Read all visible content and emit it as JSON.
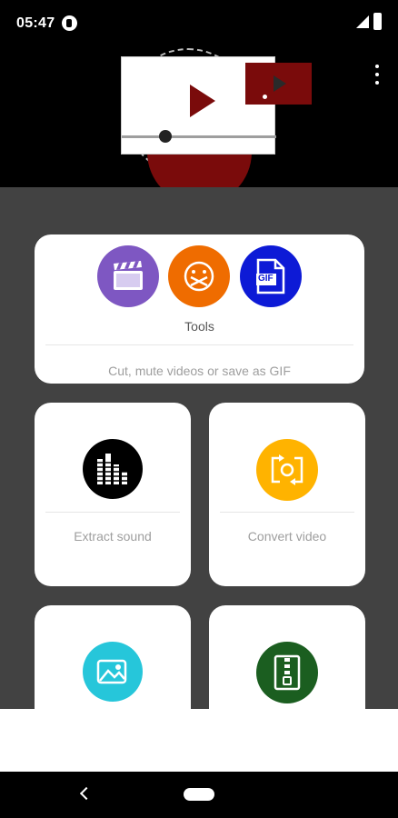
{
  "status_bar": {
    "time": "05:47",
    "app_icon": "notification-app-icon",
    "signal_icon": "cell-signal-icon",
    "battery_icon": "battery-icon"
  },
  "header": {
    "illustration_icon": "video-player-illustration",
    "menu_icon": "overflow-menu-icon"
  },
  "cards": {
    "tools": {
      "title": "Tools",
      "subtitle": "Cut, mute videos or save as GIF",
      "icons": [
        {
          "name": "clapperboard-icon",
          "color": "#7e57c2"
        },
        {
          "name": "mute-face-icon",
          "color": "#ef6c00"
        },
        {
          "name": "gif-file-icon",
          "color": "#0d1ad6"
        }
      ],
      "gif_badge": "GIF"
    },
    "extract_sound": {
      "label": "Extract sound",
      "icon": "equalizer-icon",
      "color": "#000000"
    },
    "convert_video": {
      "label": "Convert video",
      "icon": "convert-video-icon",
      "color": "#ffb300"
    },
    "images": {
      "icon": "image-icon",
      "color": "#26c6da"
    },
    "compress": {
      "icon": "zip-file-icon",
      "color": "#1b5e20"
    }
  },
  "navigation": {
    "back_icon": "back-icon",
    "home_icon": "home-pill-icon"
  },
  "colors": {
    "background": "#424242",
    "header_bg": "#000000",
    "accent_red": "#7a0b0b"
  }
}
